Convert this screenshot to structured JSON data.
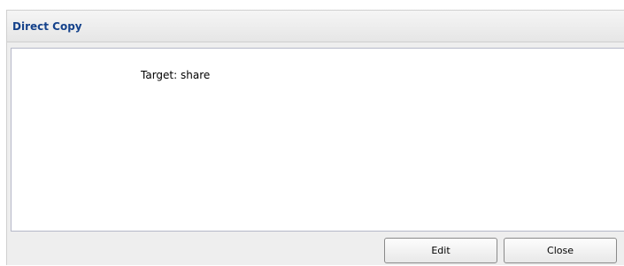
{
  "panel": {
    "title": "Direct Copy"
  },
  "body": {
    "target_label": "Target:",
    "target_value": "share"
  },
  "footer": {
    "edit_label": "Edit",
    "close_label": "Close"
  },
  "colors": {
    "title_text": "#15428b",
    "panel_background": "#eeeeee",
    "body_background": "#ffffff"
  }
}
